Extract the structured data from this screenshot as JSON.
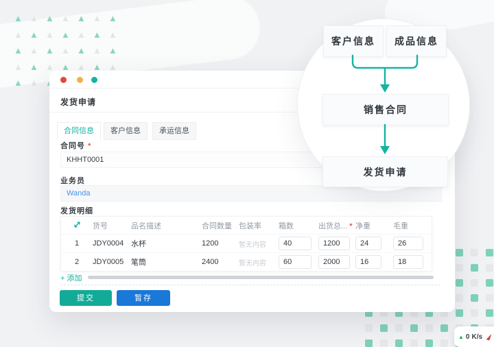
{
  "colors": {
    "accent_teal": "#13b2a0",
    "accent_blue": "#1a78d8",
    "required_red": "#e25a4d",
    "traffic_red": "#e8463c",
    "traffic_yellow": "#f0b049",
    "traffic_green": "#16b39e",
    "link_blue": "#4b92e4"
  },
  "window": {
    "title": "发货申请",
    "tabs": [
      {
        "label": "合同信息",
        "active": true
      },
      {
        "label": "客户信息",
        "active": false
      },
      {
        "label": "承运信息",
        "active": false
      }
    ],
    "contract_no": {
      "label": "合同号",
      "required_mark": "*",
      "value": "KHHT0001"
    },
    "salesman": {
      "label": "业务员",
      "value": "Wanda"
    },
    "detail": {
      "section_title": "发货明细",
      "columns": [
        "货号",
        "品名描述",
        "合同数量",
        "包装率",
        "箱数",
        "出货总...",
        "净重",
        "毛重"
      ],
      "required_mark": "*",
      "rows": [
        {
          "index": "1",
          "item_no": "JDY0004",
          "desc": "水杯",
          "contract_qty": "1200",
          "packing_rate": "暂无内容",
          "boxes": "40",
          "ship_total": "1200",
          "net": "24",
          "gross": "26"
        },
        {
          "index": "2",
          "item_no": "JDY0005",
          "desc": "笔筒",
          "contract_qty": "2400",
          "packing_rate": "暂无内容",
          "boxes": "60",
          "ship_total": "2000",
          "net": "16",
          "gross": "18"
        }
      ],
      "add_label": "+ 添加"
    },
    "buttons": {
      "submit": "提交",
      "draft": "暂存"
    }
  },
  "diagram": {
    "customer": "客户信息",
    "product": "成品信息",
    "contract": "销售合同",
    "shipment": "发货申请"
  },
  "network_indicator": {
    "value": "0",
    "unit": "K/s"
  }
}
